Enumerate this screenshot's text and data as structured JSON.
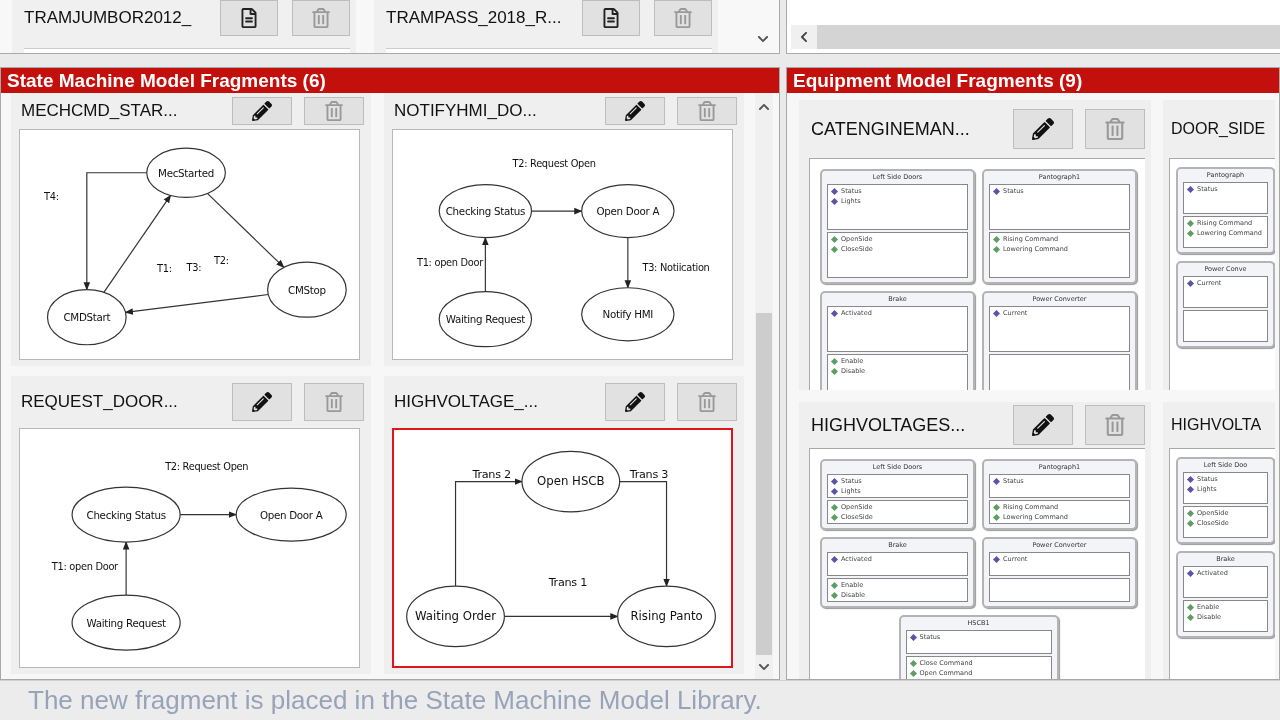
{
  "library_strip": {
    "cards": [
      {
        "title": "TRAMJUMBOR2012_"
      },
      {
        "title": "TRAMPASS_2018_R..."
      }
    ]
  },
  "state_machine_panel": {
    "title": "State Machine Model Fragments (6)",
    "fragments": [
      {
        "title": "MECHCMD_STAR...",
        "selected": false,
        "diagram": {
          "nodes": [
            "MecStarted",
            "CMDStart",
            "CMStop"
          ],
          "labels": [
            "T4:",
            "T1:",
            "T3:",
            "T2:"
          ]
        }
      },
      {
        "title": "NOTIFYHMI_DO...",
        "selected": false,
        "diagram": {
          "nodes": [
            "Checking Status",
            "Open Door A",
            "Waiting Request",
            "Notify HMI"
          ],
          "labels": [
            "T2: Request Open",
            "T1: open Door",
            "T3: Notiication"
          ]
        }
      },
      {
        "title": "REQUEST_DOOR...",
        "selected": false,
        "diagram": {
          "nodes": [
            "Checking Status",
            "Open Door A",
            "Waiting Request"
          ],
          "labels": [
            "T2: Request Open",
            "T1: open Door"
          ]
        }
      },
      {
        "title": "HIGHVOLTAGE_...",
        "selected": true,
        "diagram": {
          "nodes": [
            "Open HSCB",
            "Waiting Order",
            "Rising Panto"
          ],
          "labels": [
            "Trans 2",
            "Trans 3",
            "Trans 1"
          ]
        }
      }
    ]
  },
  "equipment_panel": {
    "title": "Equipment Model Fragments (9)",
    "fragments": [
      {
        "title": "CATENGINEMAN...",
        "classes": [
          {
            "name": "Left Side Doors",
            "attributes": [
              "Status",
              "Lights"
            ],
            "operations": [
              "OpenSide",
              "CloseSide"
            ]
          },
          {
            "name": "Pantograph1",
            "attributes": [
              "Status"
            ],
            "operations": [
              "Rising Command",
              "Lowering Command"
            ]
          },
          {
            "name": "Brake",
            "attributes": [
              "Activated"
            ],
            "operations": [
              "Enable",
              "Disable"
            ]
          },
          {
            "name": "Power Converter",
            "attributes": [
              "Current"
            ]
          }
        ]
      },
      {
        "title": "DOOR_SIDE",
        "classes": [
          {
            "name": "Pantograph",
            "attributes": [
              "Status"
            ],
            "operations": [
              "Rising Command",
              "Lowering Command"
            ]
          },
          {
            "name": "Power Conve",
            "attributes": [
              "Current"
            ]
          }
        ]
      },
      {
        "title": "HIGHVOLTAGES...",
        "classes": [
          {
            "name": "Left Side Doors",
            "attributes": [
              "Status",
              "Lights"
            ],
            "operations": [
              "OpenSide",
              "CloseSide"
            ]
          },
          {
            "name": "Pantograph1",
            "attributes": [
              "Status"
            ],
            "operations": [
              "Rising Command",
              "Lowering Command"
            ]
          },
          {
            "name": "Brake",
            "attributes": [
              "Activated"
            ],
            "operations": [
              "Enable",
              "Disable"
            ]
          },
          {
            "name": "Power Converter",
            "attributes": [
              "Current"
            ]
          },
          {
            "name": "HSCB1",
            "attributes": [
              "Status"
            ],
            "operations": [
              "Close Command",
              "Open Command"
            ]
          }
        ]
      },
      {
        "title": "HIGHVOLTA",
        "classes": [
          {
            "name": "Left Side Doo",
            "attributes": [
              "Status",
              "Lights"
            ],
            "operations": [
              "OpenSide",
              "CloseSide"
            ]
          },
          {
            "name": "Brake",
            "attributes": [
              "Activated"
            ],
            "operations": [
              "Enable",
              "Disable"
            ]
          }
        ]
      }
    ]
  },
  "status_message": "The new fragment is placed in the State Machine Model Library."
}
